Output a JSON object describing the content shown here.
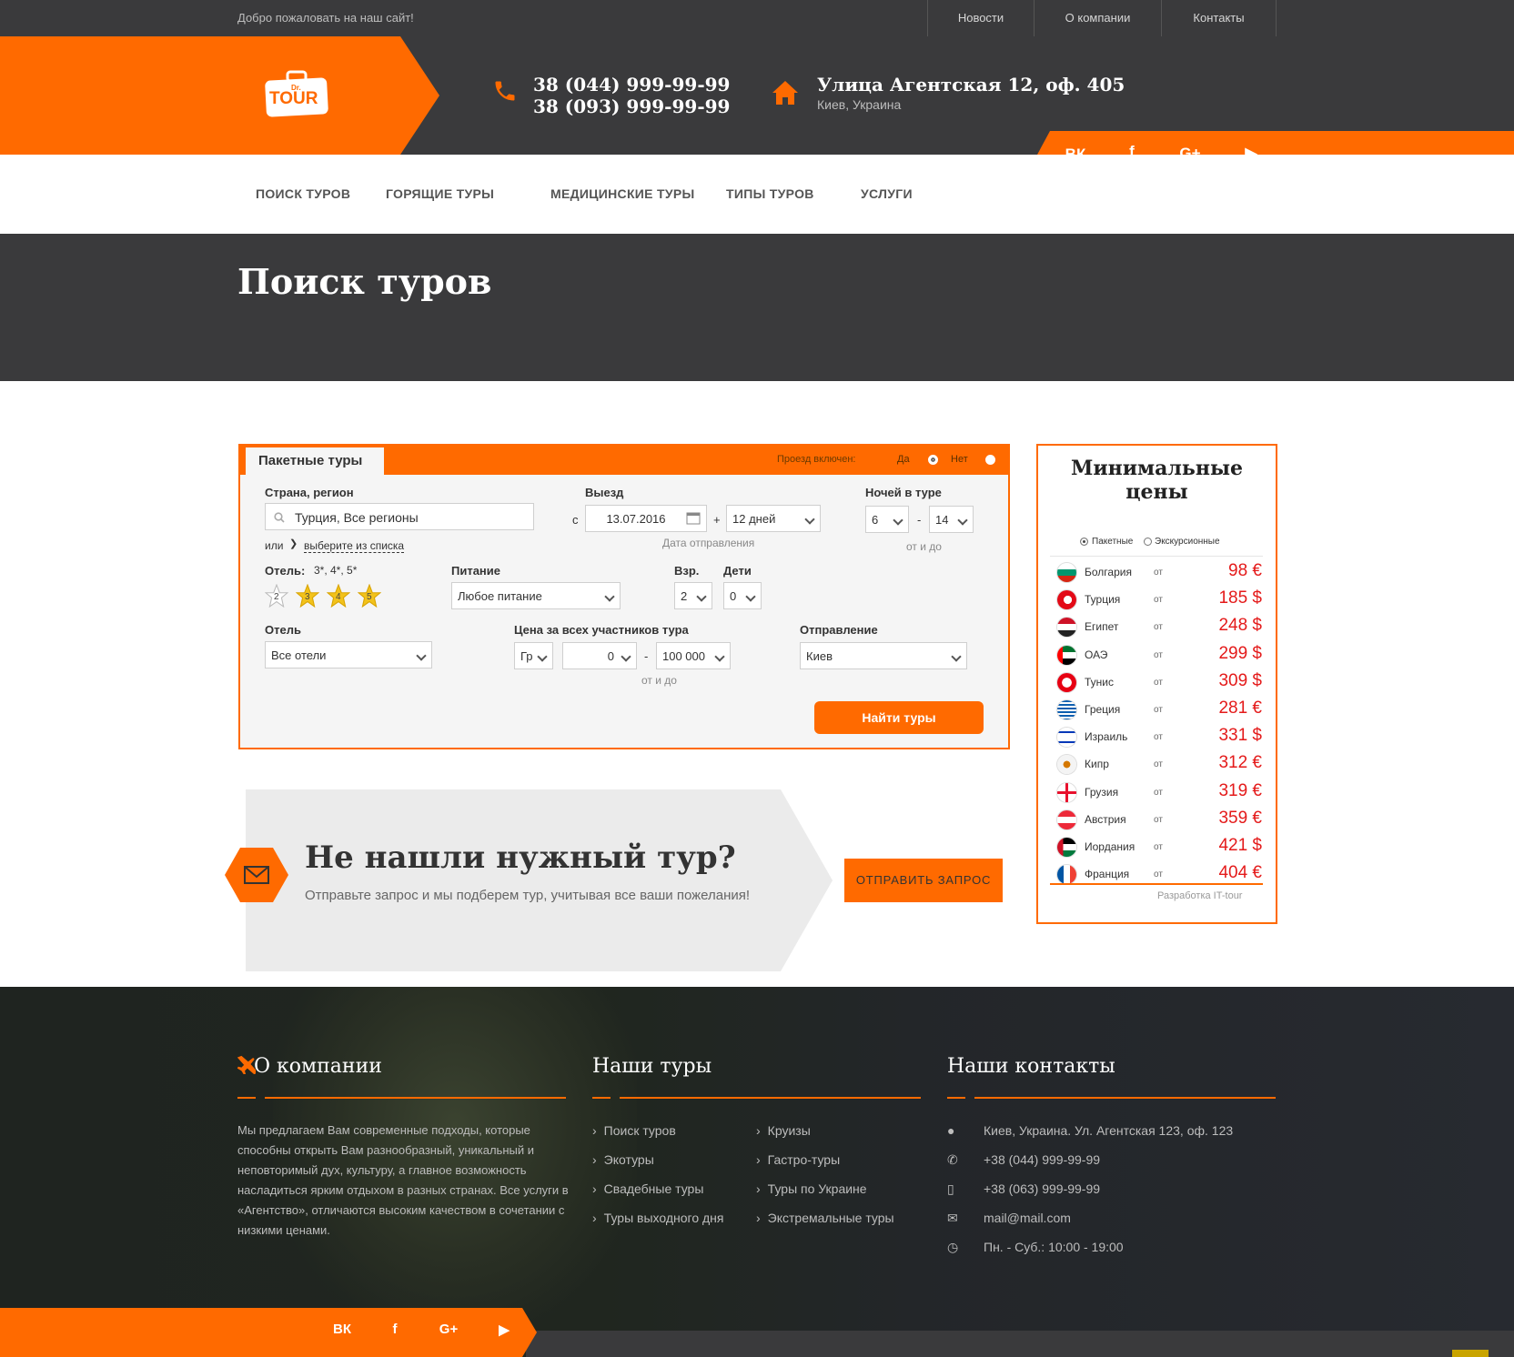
{
  "topbar": {
    "welcome": "Добро пожаловать на наш сайт!",
    "links": [
      "Новости",
      "О компании",
      "Контакты"
    ]
  },
  "header": {
    "logo_small": "Dr.",
    "logo_big": "TOUR",
    "phone1": "38 (044) 999-99-99",
    "phone2": "38 (093) 999-99-99",
    "address": "Улица Агентская 12, оф. 405",
    "city": "Киев, Украина",
    "social": [
      "ВК",
      "f",
      "G+",
      "▶"
    ]
  },
  "nav": [
    "ПОИСК ТУРОВ",
    "ГОРЯЩИЕ ТУРЫ",
    "МЕДИЦИНСКИЕ ТУРЫ",
    "ТИПЫ ТУРОВ",
    "УСЛУГИ"
  ],
  "hero": {
    "title": "Поиск туров"
  },
  "search": {
    "tab": "Пакетные туры",
    "travel_included": "Проезд включен:",
    "yes": "Да",
    "no": "Нет",
    "country_label": "Страна, регион",
    "country_value": "Турция, Все регионы",
    "or": "или",
    "choose_list": "выберите из списка",
    "departure_label": "Выезд",
    "from": "с",
    "date": "13.07.2016",
    "plus": "+",
    "days": "12 дней",
    "date_hint": "Дата отправления",
    "nights_label": "Ночей в туре",
    "nights_from": "6",
    "nights_to": "14",
    "dash": "-",
    "range_hint": "от и до",
    "hotel_stars_label": "Отель:",
    "hotel_stars_value": "3*, 4*, 5*",
    "stars": [
      "2",
      "3",
      "4",
      "5"
    ],
    "food_label": "Питание",
    "food_value": "Любое питание",
    "adults_label": "Взр.",
    "adults_value": "2",
    "kids_label": "Дети",
    "kids_value": "0",
    "hotel_label": "Отель",
    "hotel_value": "Все отели",
    "price_label": "Цена за всех участников тура",
    "currency": "Гр",
    "price_from": "0",
    "price_to": "100 000",
    "price_hint": "от и до",
    "departure_city_label": "Отправление",
    "departure_city": "Киев",
    "button": "Найти туры"
  },
  "prices": {
    "title": "Минимальные цены",
    "opt_package": "Пакетные",
    "opt_excursion": "Экскурсионные",
    "from_word": "от",
    "rows": [
      {
        "name": "Болгария",
        "value": "98 €"
      },
      {
        "name": "Турция",
        "value": "185 $"
      },
      {
        "name": "Египет",
        "value": "248 $"
      },
      {
        "name": "ОАЭ",
        "value": "299 $"
      },
      {
        "name": "Тунис",
        "value": "309 $"
      },
      {
        "name": "Греция",
        "value": "281 €"
      },
      {
        "name": "Израиль",
        "value": "331 $"
      },
      {
        "name": "Кипр",
        "value": "312 €"
      },
      {
        "name": "Грузия",
        "value": "319 €"
      },
      {
        "name": "Австрия",
        "value": "359 €"
      },
      {
        "name": "Иордания",
        "value": "421 $"
      },
      {
        "name": "Франция",
        "value": "404 €"
      }
    ],
    "credit": "Разработка IT-tour"
  },
  "request": {
    "title": "Не нашли нужный тур?",
    "subtitle": "Отправьте запрос и мы подберем тур, учитывая все ваши пожелания!",
    "button": "ОТПРАВИТЬ ЗАПРОС"
  },
  "footer": {
    "about_title": "О компании",
    "about_text": "Мы предлагаем Вам современные подходы, которые способны открыть Вам разнообразный, уникальный и неповторимый дух, культуру, а главное возможность насладиться ярким отдыхом в разных странах. Все услуги в «Агентство», отличаются высоким качеством в сочетании с низкими ценами.",
    "tours_title": "Наши туры",
    "tours_left": [
      "Поиск туров",
      "Экотуры",
      "Свадебные туры",
      "Туры выходного дня"
    ],
    "tours_right": [
      "Круизы",
      "Гастро-туры",
      "Туры по Украине",
      "Экстремальные туры"
    ],
    "contacts_title": "Наши контакты",
    "contacts": [
      "Киев, Украина. Ул. Агентская 123, оф. 123",
      "+38 (044) 999-99-99",
      "+38 (063) 999-99-99",
      "mail@mail.com",
      "Пн. - Суб.: 10:00 - 19:00"
    ],
    "social": [
      "ВК",
      "f",
      "G+",
      "▶"
    ]
  },
  "colors": {
    "accent": "#ff6a00",
    "dark": "#3a3a3c",
    "price": "#e41a1a"
  }
}
